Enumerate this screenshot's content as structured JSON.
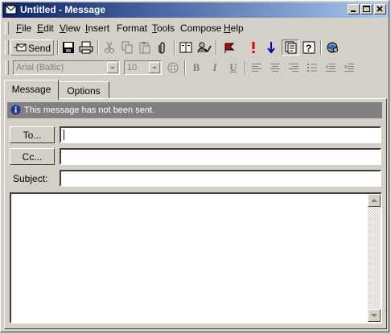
{
  "window": {
    "title": "Untitled - Message"
  },
  "menu": [
    {
      "label": "File",
      "key": "F",
      "rest": "ile"
    },
    {
      "label": "Edit",
      "key": "E",
      "rest": "dit"
    },
    {
      "label": "View",
      "key": "V",
      "rest": "iew"
    },
    {
      "label": "Insert",
      "key": "I",
      "rest": "nsert"
    },
    {
      "label": "Format",
      "key": "",
      "rest": "Format"
    },
    {
      "label": "Tools",
      "key": "T",
      "rest": "ools"
    },
    {
      "label": "Compose",
      "key": "",
      "rest": "Compose"
    },
    {
      "label": "Help",
      "key": "H",
      "rest": "elp"
    }
  ],
  "toolbar": {
    "send_label": "Send"
  },
  "format_bar": {
    "font": "Arial (Baltic)",
    "size": "10"
  },
  "tabs": [
    {
      "label": "Message"
    },
    {
      "label": "Options"
    }
  ],
  "info": {
    "message": "This message has not been sent."
  },
  "fields": {
    "to_label": "To...",
    "cc_label": "Cc...",
    "subject_label": "Subject:",
    "to_value": "",
    "cc_value": "",
    "subject_value": ""
  },
  "colors": {
    "titlebar_start": "#0a246a",
    "titlebar_end": "#a6caf0",
    "face": "#d4d0c8",
    "infobar": "#808080"
  }
}
